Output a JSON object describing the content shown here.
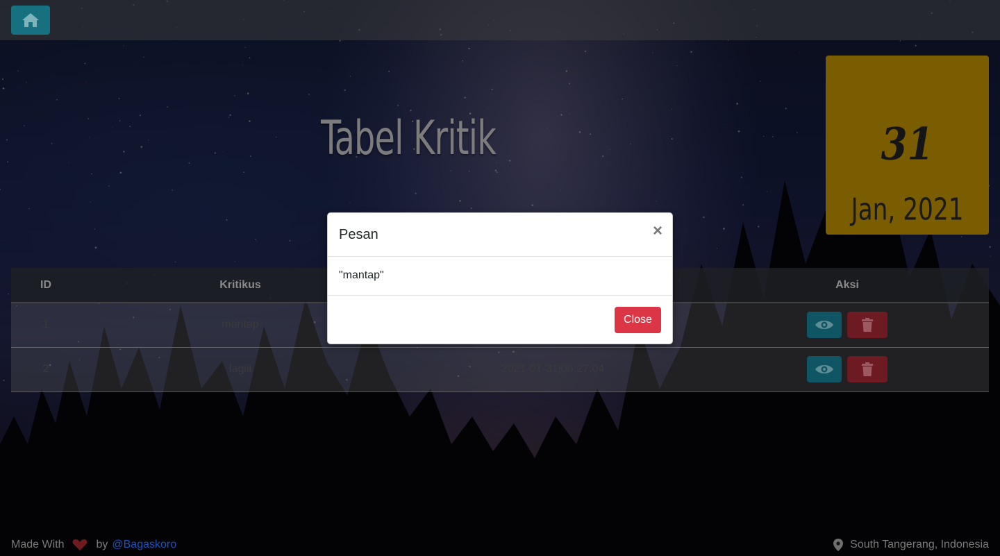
{
  "navbar": {
    "home_icon": "home-icon"
  },
  "page": {
    "title": "Tabel Kritik"
  },
  "date_card": {
    "day": "31",
    "month_year": "Jan, 2021"
  },
  "table": {
    "headers": [
      "ID",
      "Kritikus",
      "",
      "Aksi"
    ],
    "rows": [
      {
        "id": "1",
        "kritikus": "mantap",
        "tanggal": ""
      },
      {
        "id": "2",
        "kritikus": "lagiii",
        "tanggal": "2021-01-31|06:27:04"
      }
    ]
  },
  "modal": {
    "title": "Pesan",
    "close_symbol": "×",
    "body": "\"mantap\"",
    "close_label": "Close"
  },
  "footer": {
    "made_with": "Made With",
    "by": "by",
    "author": "@Bagaskoro",
    "location": "South Tangerang, Indonesia"
  },
  "colors": {
    "accent_info": "#17a2b8",
    "danger": "#dc3545",
    "date_card": "#c99a00"
  }
}
